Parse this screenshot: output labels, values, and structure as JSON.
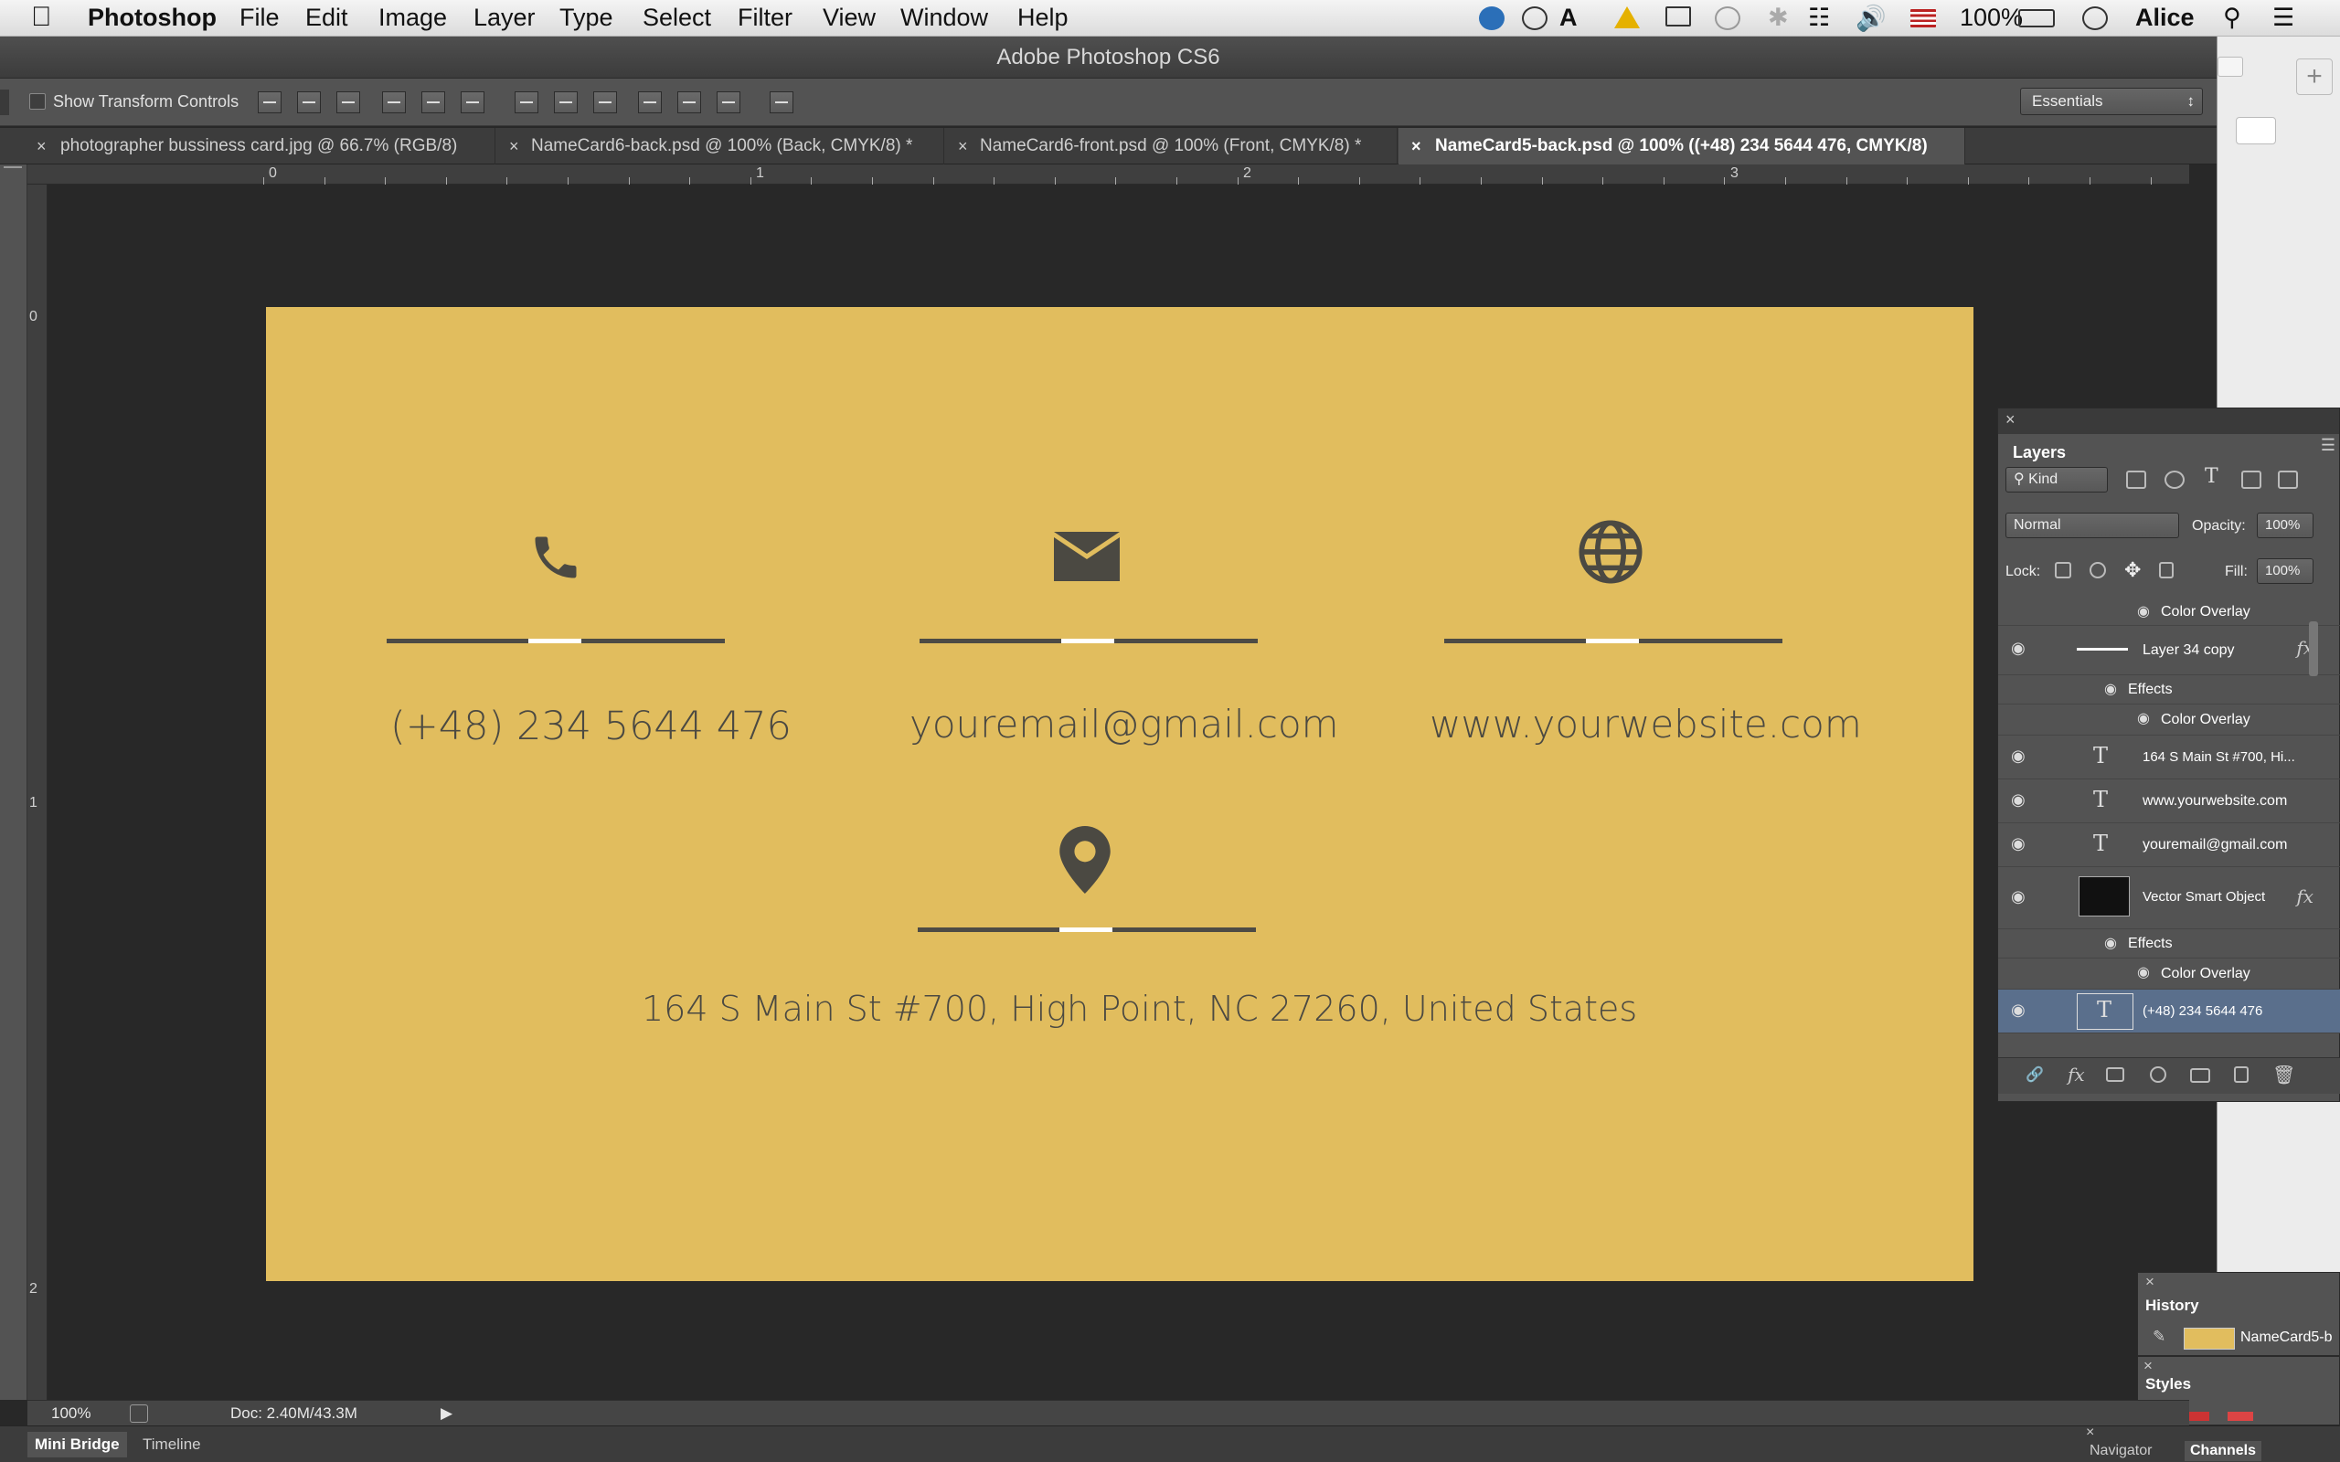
{
  "menubar": {
    "app": "Photoshop",
    "items": [
      "File",
      "Edit",
      "Image",
      "Layer",
      "Type",
      "Select",
      "Filter",
      "View",
      "Window",
      "Help"
    ],
    "battery": "100%",
    "user": "Alice"
  },
  "window": {
    "title": "Adobe Photoshop CS6"
  },
  "options": {
    "show_transform": "Show Transform Controls",
    "workspace": "Essentials"
  },
  "tabs": [
    {
      "label": "photographer bussiness card.jpg @ 66.7% (RGB/8)"
    },
    {
      "label": "NameCard6-back.psd @ 100% (Back, CMYK/8) *"
    },
    {
      "label": "NameCard6-front.psd @ 100% (Front, CMYK/8) *"
    },
    {
      "label": "NameCard5-back.psd @ 100% ((+48) 234 5644 476, CMYK/8)"
    }
  ],
  "ruler": {
    "h": [
      "0",
      "1",
      "2",
      "3"
    ],
    "v": [
      "0",
      "1",
      "2"
    ]
  },
  "card": {
    "phone": "(+48) 234 5644 476",
    "email": "youremail@gmail.com",
    "website": "www.yourwebsite.com",
    "address": "164 S Main St #700, High Point, NC 27260, United States",
    "bg_color": "#e1bd5e",
    "icons": [
      "phone-icon",
      "envelope-icon",
      "globe-icon",
      "map-pin-icon"
    ]
  },
  "status": {
    "zoom": "100%",
    "doc": "Doc: 2.40M/43.3M"
  },
  "bottom_tabs": [
    "Mini Bridge",
    "Timeline"
  ],
  "layers": {
    "title": "Layers",
    "filter": "Kind",
    "blend": "Normal",
    "opacity_label": "Opacity:",
    "opacity": "100%",
    "lock_label": "Lock:",
    "fill_label": "Fill:",
    "fill": "100%",
    "rows": [
      {
        "name": "Color Overlay"
      },
      {
        "name": "Layer 34 copy"
      },
      {
        "name": "Effects"
      },
      {
        "name": "Color Overlay"
      },
      {
        "name": "164 S Main St #700, Hi..."
      },
      {
        "name": "www.yourwebsite.com"
      },
      {
        "name": "youremail@gmail.com"
      },
      {
        "name": "Vector Smart Object"
      },
      {
        "name": "Effects"
      },
      {
        "name": "Color Overlay"
      },
      {
        "name": "(+48) 234 5644 476"
      }
    ]
  },
  "history": {
    "title": "History",
    "item": "NameCard5-b"
  },
  "styles": {
    "title": "Styles"
  },
  "bottom_panels": [
    "Navigator",
    "Channels"
  ]
}
